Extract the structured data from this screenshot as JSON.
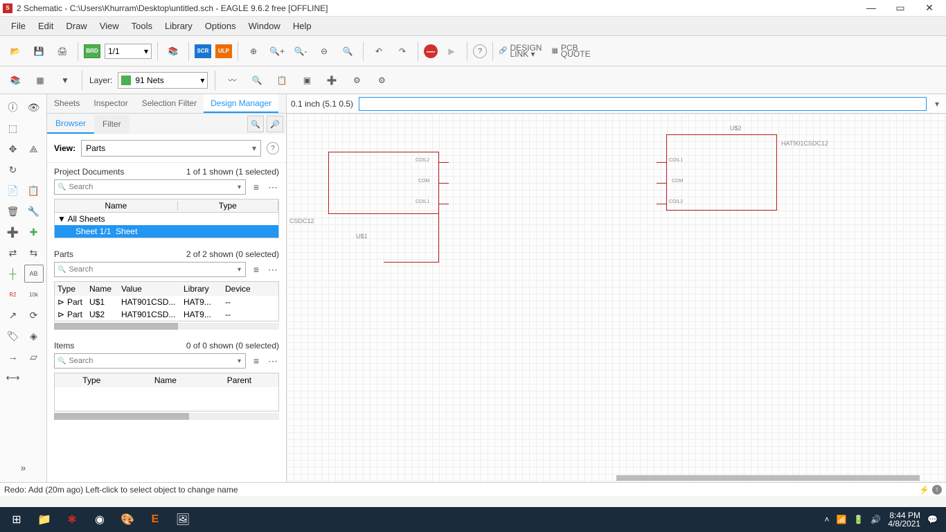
{
  "title": "2 Schematic - C:\\Users\\Khurram\\Desktop\\untitled.sch - EAGLE 9.6.2 free [OFFLINE]",
  "menu": [
    "File",
    "Edit",
    "Draw",
    "View",
    "Tools",
    "Library",
    "Options",
    "Window",
    "Help"
  ],
  "toolbar1": {
    "brd": "BRD",
    "sheet": "1/1",
    "scr": "SCR",
    "ulp": "ULP",
    "designlink1": "DESIGN",
    "designlink2": "LINK ▾",
    "pcb1": "PCB",
    "pcb2": "QUOTE"
  },
  "toolbar2": {
    "layer_label": "Layer:",
    "layer_value": "91 Nets"
  },
  "panel": {
    "tabs1": [
      "Sheets",
      "Inspector",
      "Selection Filter",
      "Design Manager"
    ],
    "tabs1_active": 3,
    "tabs2": [
      "Browser",
      "Filter"
    ],
    "tabs2_active": 0,
    "view_label": "View:",
    "view_value": "Parts",
    "docs": {
      "label": "Project Documents",
      "count": "1 of 1 shown (1 selected)",
      "search_placeholder": "Search",
      "cols": [
        "Name",
        "Type"
      ],
      "topnode": "All Sheets",
      "row_name": "Sheet 1/1",
      "row_type": "Sheet"
    },
    "parts": {
      "label": "Parts",
      "count": "2 of 2 shown (0 selected)",
      "search_placeholder": "Search",
      "cols": [
        "Type",
        "Name",
        "Value",
        "Library",
        "Device"
      ],
      "rows": [
        {
          "type": "Part",
          "name": "U$1",
          "value": "HAT901CSD...",
          "library": "HAT9...",
          "device": "--"
        },
        {
          "type": "Part",
          "name": "U$2",
          "value": "HAT901CSD...",
          "library": "HAT9...",
          "device": "--"
        }
      ]
    },
    "items": {
      "label": "Items",
      "count": "0 of 0 shown (0 selected)",
      "search_placeholder": "Search",
      "cols": [
        "Type",
        "Name",
        "Parent"
      ]
    }
  },
  "canvas": {
    "coord": "0.1 inch (5.1 0.5)",
    "u1_ref": "U$1",
    "u1_val": "CSDC12",
    "u2_ref": "U$2",
    "u2_val": "HAT901CSDC12",
    "pins_u1": [
      "COIL2",
      "COM",
      "COIL1"
    ],
    "pins_u2": [
      "COIL1",
      "COM",
      "COIL2"
    ]
  },
  "status": "Redo: Add (20m ago) Left-click to select object to change name",
  "taskbar": {
    "time": "8:44 PM",
    "date": "4/8/2021"
  }
}
